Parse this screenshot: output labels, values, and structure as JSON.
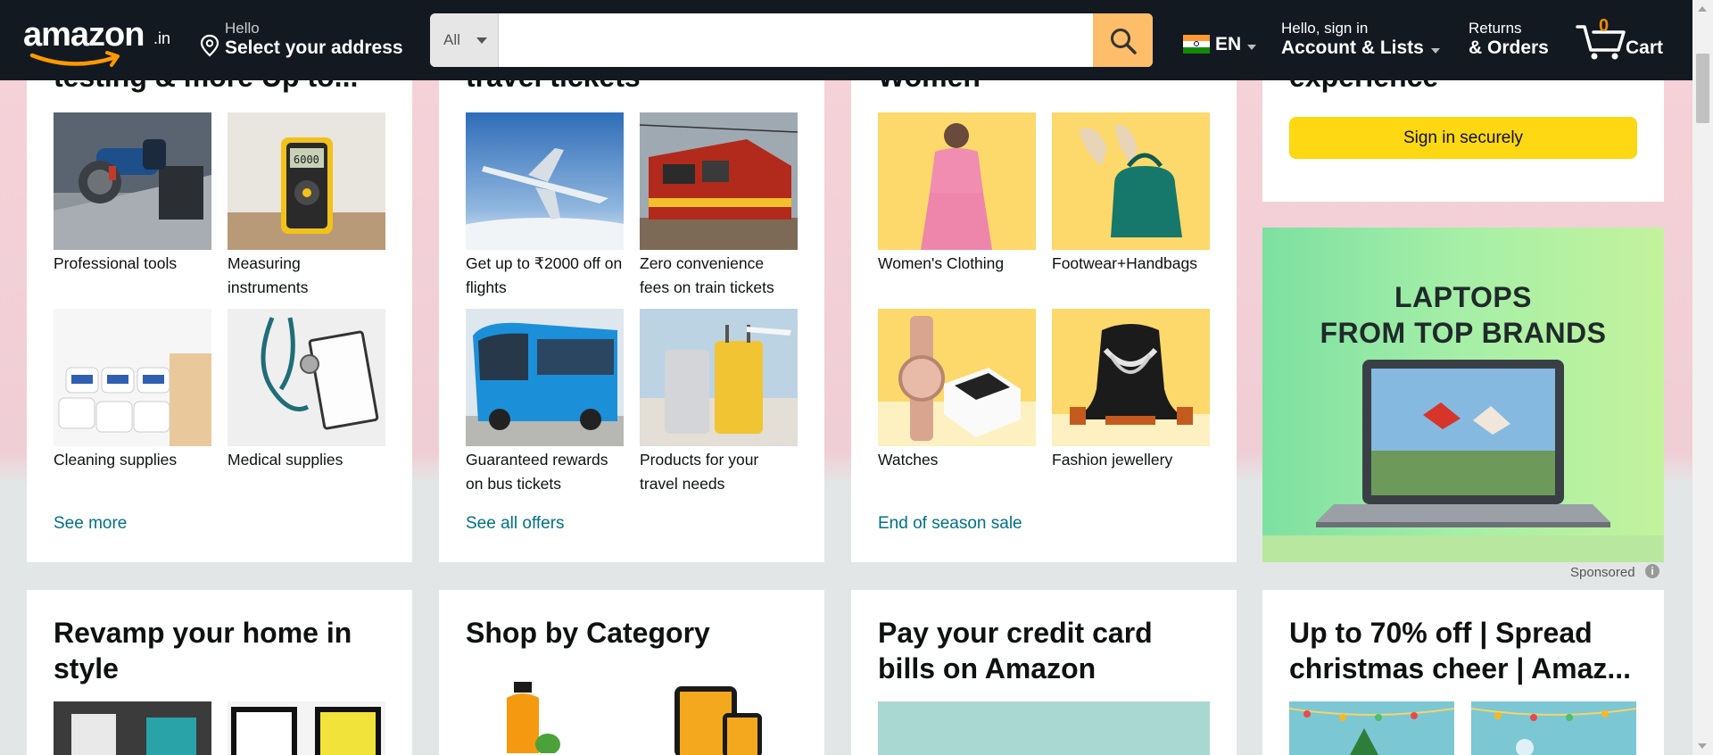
{
  "header": {
    "logo_text": "amazon",
    "logo_tld": ".in",
    "address_line1": "Hello",
    "address_line2": "Select your address",
    "search_category": "All",
    "search_placeholder": "",
    "language": "EN",
    "account_line1": "Hello, sign in",
    "account_line2": "Account & Lists",
    "orders_line1": "Returns",
    "orders_line2": "& Orders",
    "cart_count": "0",
    "cart_label": "Cart",
    "colors": {
      "nav_bg": "#131921",
      "search_button": "#febd69",
      "cart_count": "#f08804"
    }
  },
  "cards_row1": [
    {
      "title_partial": "testing & more Up to...",
      "items": [
        {
          "label": "Professional tools",
          "icon": "angle-grinder-image"
        },
        {
          "label": "Measuring instruments",
          "icon": "multimeter-image"
        },
        {
          "label": "Cleaning supplies",
          "icon": "tissue-rolls-image"
        },
        {
          "label": "Medical supplies",
          "icon": "stethoscope-image"
        }
      ],
      "link": "See more"
    },
    {
      "title_partial": "travel tickets",
      "items": [
        {
          "label": "Get up to ₹2000 off on flights",
          "icon": "airplane-image"
        },
        {
          "label": "Zero convenience fees on train tickets",
          "icon": "train-image"
        },
        {
          "label": "Guaranteed rewards on bus tickets",
          "icon": "bus-image"
        },
        {
          "label": "Products for your travel needs",
          "icon": "luggage-image"
        }
      ],
      "link": "See all offers"
    },
    {
      "title_partial": "Women",
      "items": [
        {
          "label": "Women's Clothing",
          "icon": "clothing-image"
        },
        {
          "label": "Footwear+Handbags",
          "icon": "footwear-handbag-image"
        },
        {
          "label": "Watches",
          "icon": "watch-image"
        },
        {
          "label": "Fashion jewellery",
          "icon": "necklace-image"
        }
      ],
      "link": "End of season sale"
    },
    {
      "title_partial": "experience",
      "button": "Sign in securely"
    }
  ],
  "ad": {
    "headline_line1": "LAPTOPS",
    "headline_line2": "FROM TOP BRANDS",
    "sponsored": "Sponsored",
    "info_glyph": "i"
  },
  "cards_row2": [
    {
      "title": "Revamp your home in style"
    },
    {
      "title": "Shop by Category"
    },
    {
      "title": "Pay your credit card bills on Amazon"
    },
    {
      "title": "Up to 70% off | Spread christmas cheer | Amaz..."
    }
  ]
}
